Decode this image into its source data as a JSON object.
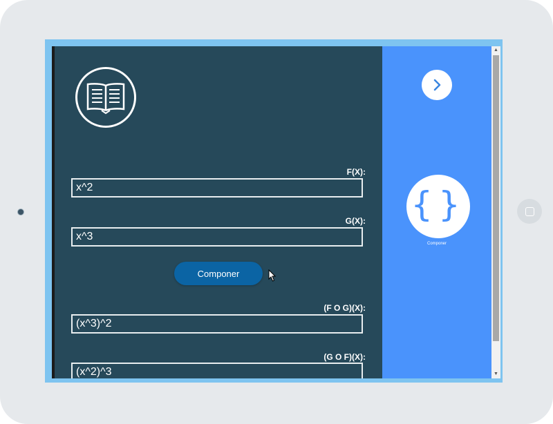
{
  "app": {
    "fx_label": "F(X):",
    "fx_value": "x^2",
    "gx_label": "G(X):",
    "gx_value": "x^3",
    "compose_button": "Componer",
    "fog_label": "(F O G)(X):",
    "fog_value": "(x^3)^2",
    "gof_label": "(G O F)(X):",
    "gof_value": "(x^2)^3"
  },
  "side": {
    "braces_caption": "Componer"
  },
  "icons": {
    "logo": "open-book-icon",
    "next": "chevron-right-icon",
    "braces": "curly-braces-icon"
  },
  "colors": {
    "main_panel": "#26495a",
    "side_panel": "#4a93fc",
    "button": "#0b64a4"
  }
}
